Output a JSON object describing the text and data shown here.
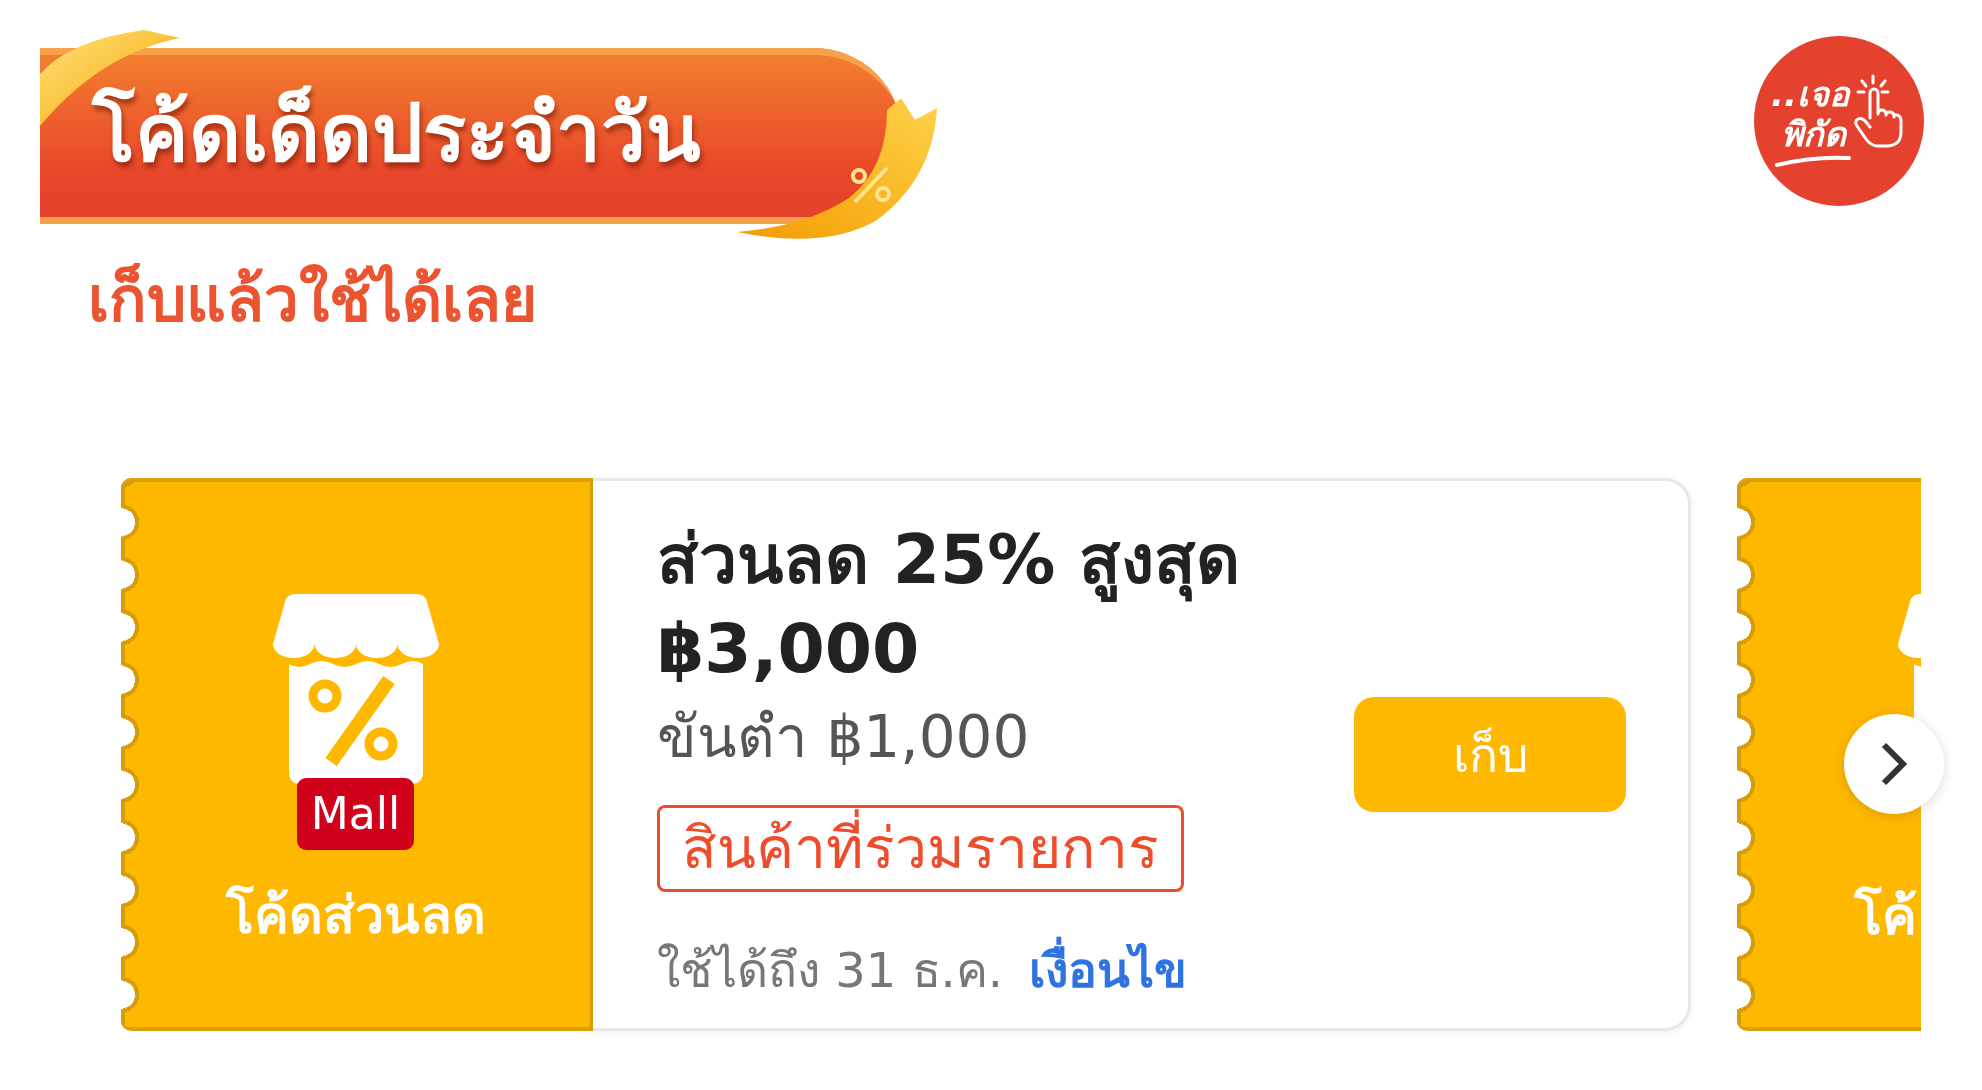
{
  "header": {
    "title": "โค้ดเด็ดประจำวัน",
    "subtitle": "เก็บแล้วใช้ได้เลย"
  },
  "logo": {
    "lines": [
      "..เจอ",
      "พิกัด"
    ]
  },
  "coupons": [
    {
      "kind": "full",
      "badge": "Mall",
      "label": "โค้ดส่วนลด",
      "title": "ส่วนลด 25% สูงสุด ฿3,000",
      "min_spend": "ขันตำ ฿1,000",
      "tag": "สินค้าที่ร่วมรายการ",
      "expiry": "ใช้ได้ถึง 31 ธ.ค.",
      "terms_link": "เงื่อนไข",
      "button": "เก็บ"
    },
    {
      "kind": "partial",
      "label": "โค้"
    }
  ]
}
